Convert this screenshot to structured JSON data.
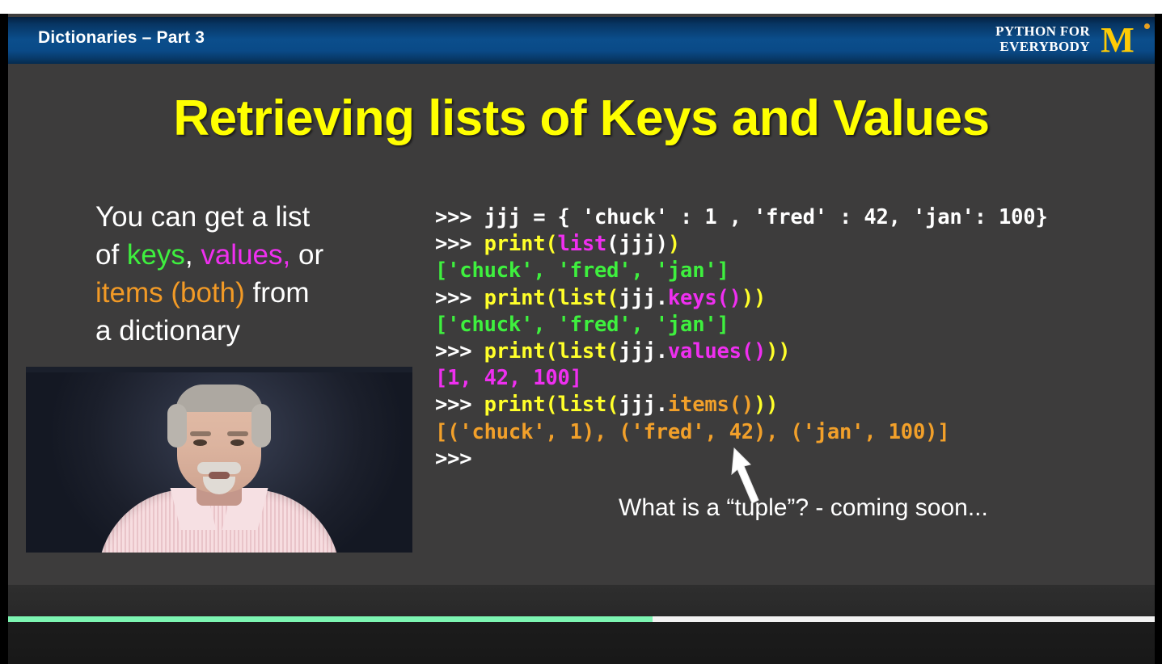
{
  "header": {
    "title": "Dictionaries – Part 3",
    "brand_line1": "PYTHON FOR",
    "brand_line2": "EVERYBODY",
    "logo_letter": "M",
    "logo_color": "#ffcb05",
    "bar_color": "#0b4e8c"
  },
  "slide": {
    "title": "Retrieving lists of Keys and Values",
    "title_color": "#ffff00",
    "background_color": "#3d3c3c",
    "prose": {
      "line1": "You can get a list",
      "line2_prefix": "of ",
      "line2_keys": "keys",
      "line2_mid": ", ",
      "line2_values": "values,",
      "line2_suffix": " or",
      "line3_items": "items (both)",
      "line3_suffix": " from",
      "line4": "a dictionary",
      "keys_color": "#3ef03e",
      "values_color": "#ef2ff0",
      "items_color": "#f29a26"
    },
    "caption": "What is a “tuple”? - coming soon...",
    "code_lines": [
      {
        "id": "line-1",
        "parts": [
          {
            "text": ">>> jjj = { 'chuck' : 1 , 'fred' : 42, 'jan': 100}",
            "color": "white"
          }
        ]
      },
      {
        "id": "line-2",
        "parts": [
          {
            "text": ">>> ",
            "color": "white"
          },
          {
            "text": "print(",
            "color": "yellow"
          },
          {
            "text": "list",
            "color": "magenta"
          },
          {
            "text": "(jjj)",
            "color": "white"
          },
          {
            "text": ")",
            "color": "yellow"
          }
        ]
      },
      {
        "id": "line-3",
        "parts": [
          {
            "text": "['chuck', 'fred', 'jan']",
            "color": "green"
          }
        ]
      },
      {
        "id": "line-4",
        "parts": [
          {
            "text": ">>> ",
            "color": "white"
          },
          {
            "text": "print(list(",
            "color": "yellow"
          },
          {
            "text": "jjj.",
            "color": "white"
          },
          {
            "text": "keys()",
            "color": "magenta"
          },
          {
            "text": "))",
            "color": "yellow"
          }
        ]
      },
      {
        "id": "line-5",
        "parts": [
          {
            "text": "['chuck', 'fred', 'jan']",
            "color": "green"
          }
        ]
      },
      {
        "id": "line-6",
        "parts": [
          {
            "text": ">>> ",
            "color": "white"
          },
          {
            "text": "print(list(",
            "color": "yellow"
          },
          {
            "text": "jjj.",
            "color": "white"
          },
          {
            "text": "values()",
            "color": "magenta"
          },
          {
            "text": "))",
            "color": "yellow"
          }
        ]
      },
      {
        "id": "line-7",
        "parts": [
          {
            "text": "[1, 42, 100]",
            "color": "magenta"
          }
        ]
      },
      {
        "id": "line-8",
        "parts": [
          {
            "text": ">>> ",
            "color": "white"
          },
          {
            "text": "print(list(",
            "color": "yellow"
          },
          {
            "text": "jjj.",
            "color": "white"
          },
          {
            "text": "items()",
            "color": "orange"
          },
          {
            "text": "))",
            "color": "yellow"
          }
        ]
      },
      {
        "id": "line-9",
        "parts": [
          {
            "text": "[('chuck', 1), ('fred', 42), ('jan', 100)]",
            "color": "orange"
          }
        ]
      },
      {
        "id": "line-10",
        "parts": [
          {
            "text": ">>>",
            "color": "white"
          }
        ]
      }
    ]
  },
  "player": {
    "progress_percent": 56.2,
    "progress_fill_color": "#7df5b2",
    "progress_track_color": "#f2f2f2"
  }
}
